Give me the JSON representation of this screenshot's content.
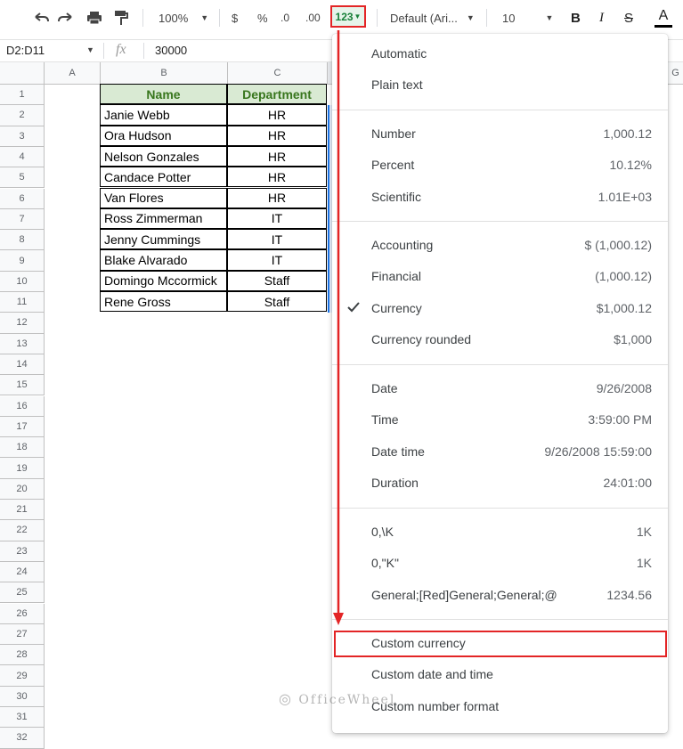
{
  "toolbar": {
    "zoom": "100%",
    "currency_symbol": "$",
    "percent_symbol": "%",
    "decrease_decimal": ".0",
    "increase_decimal": ".00",
    "more_formats": "123",
    "font": "Default (Ari...",
    "font_size": "10",
    "bold": "B",
    "italic": "I",
    "strike": "S",
    "text_color": "A"
  },
  "formula_bar": {
    "range": "D2:D11",
    "fx": "fx",
    "value": "30000"
  },
  "columns": [
    "A",
    "B",
    "C",
    "G"
  ],
  "row_numbers": [
    "1",
    "2",
    "3",
    "4",
    "5",
    "6",
    "7",
    "8",
    "9",
    "10",
    "11",
    "12",
    "13",
    "14",
    "15",
    "16",
    "17",
    "18",
    "19",
    "20",
    "21",
    "22",
    "23",
    "24",
    "25",
    "26",
    "27",
    "28",
    "29",
    "30",
    "31",
    "32"
  ],
  "table": {
    "headers": [
      "Name",
      "Department"
    ],
    "rows": [
      [
        "Janie Webb",
        "HR"
      ],
      [
        "Ora Hudson",
        "HR"
      ],
      [
        "Nelson Gonzales",
        "HR"
      ],
      [
        "Candace Potter",
        "HR"
      ],
      [
        "Van Flores",
        "HR"
      ],
      [
        "Ross Zimmerman",
        "IT"
      ],
      [
        "Jenny Cummings",
        "IT"
      ],
      [
        "Blake Alvarado",
        "IT"
      ],
      [
        "Domingo Mccormick",
        "Staff"
      ],
      [
        "Rene Gross",
        "Staff"
      ]
    ]
  },
  "menu": {
    "groups": [
      [
        {
          "label": "Automatic",
          "value": ""
        },
        {
          "label": "Plain text",
          "value": ""
        }
      ],
      [
        {
          "label": "Number",
          "value": "1,000.12"
        },
        {
          "label": "Percent",
          "value": "10.12%"
        },
        {
          "label": "Scientific",
          "value": "1.01E+03"
        }
      ],
      [
        {
          "label": "Accounting",
          "value": "$ (1,000.12)"
        },
        {
          "label": "Financial",
          "value": "(1,000.12)"
        },
        {
          "label": "Currency",
          "value": "$1,000.12",
          "checked": true
        },
        {
          "label": "Currency rounded",
          "value": "$1,000"
        }
      ],
      [
        {
          "label": "Date",
          "value": "9/26/2008"
        },
        {
          "label": "Time",
          "value": "3:59:00 PM"
        },
        {
          "label": "Date time",
          "value": "9/26/2008 15:59:00"
        },
        {
          "label": "Duration",
          "value": "24:01:00"
        }
      ],
      [
        {
          "label": "0,\\K",
          "value": "1K"
        },
        {
          "label": "0,\"K\"",
          "value": "1K"
        },
        {
          "label": "General;[Red]General;General;@",
          "value": "1234.56"
        }
      ],
      [
        {
          "label": "Custom currency",
          "value": ""
        },
        {
          "label": "Custom date and time",
          "value": ""
        },
        {
          "label": "Custom number format",
          "value": ""
        }
      ]
    ]
  },
  "watermark": "OfficeWheel",
  "colors": {
    "header_fill": "#d9ead3",
    "header_text": "#38761d",
    "highlight": "#e32526",
    "format_button": "#188038",
    "selection": "#1a73e8"
  }
}
